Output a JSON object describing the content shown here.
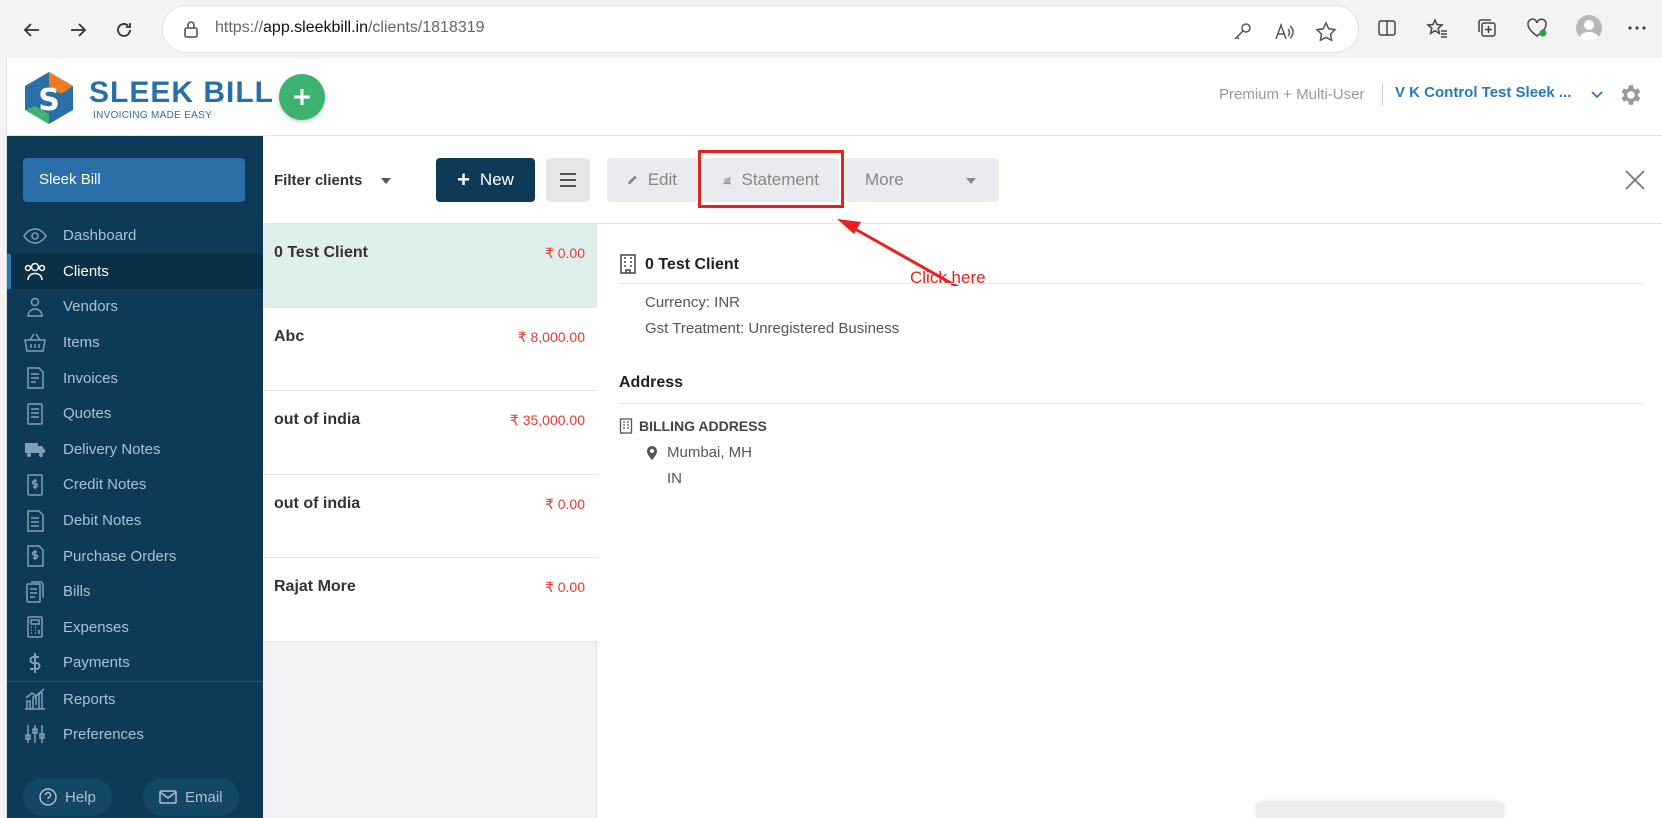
{
  "browser": {
    "url_prefix": "https://",
    "url_domain": "app.sleekbill.in",
    "url_path": "/clients/1818319"
  },
  "header": {
    "logo_text": "SLEEK BILL",
    "logo_tagline": "INVOICING MADE EASY",
    "plan": "Premium + Multi-User",
    "company": "V K Control Test Sleek ..."
  },
  "sidebar": {
    "brand_button": "Sleek Bill",
    "items": [
      {
        "label": "Dashboard",
        "icon": "eye-icon"
      },
      {
        "label": "Clients",
        "icon": "users-icon",
        "active": true
      },
      {
        "label": "Vendors",
        "icon": "vendor-icon"
      },
      {
        "label": "Items",
        "icon": "basket-icon"
      },
      {
        "label": "Invoices",
        "icon": "invoice-icon"
      },
      {
        "label": "Quotes",
        "icon": "quote-icon"
      },
      {
        "label": "Delivery Notes",
        "icon": "truck-icon"
      },
      {
        "label": "Credit Notes",
        "icon": "credit-note-icon"
      },
      {
        "label": "Debit Notes",
        "icon": "debit-note-icon"
      },
      {
        "label": "Purchase Orders",
        "icon": "purchase-order-icon"
      },
      {
        "label": "Bills",
        "icon": "bills-icon"
      },
      {
        "label": "Expenses",
        "icon": "calculator-icon"
      },
      {
        "label": "Payments",
        "icon": "dollar-icon"
      },
      {
        "label": "Reports",
        "icon": "chart-icon"
      },
      {
        "label": "Preferences",
        "icon": "sliders-icon"
      }
    ],
    "help_label": "Help",
    "email_label": "Email"
  },
  "list": {
    "filter_label": "Filter clients",
    "new_label": "New",
    "clients": [
      {
        "name": "0 Test Client",
        "amount": "₹ 0.00",
        "selected": true
      },
      {
        "name": "Abc",
        "amount": "₹ 8,000.00"
      },
      {
        "name": "out of india",
        "amount": "₹ 35,000.00"
      },
      {
        "name": "out of india",
        "amount": "₹ 0.00"
      },
      {
        "name": "Rajat More",
        "amount": "₹ 0.00"
      }
    ]
  },
  "detail": {
    "edit_label": "Edit",
    "statement_label": "Statement",
    "more_label": "More",
    "annotation": "Click here",
    "client_name": "0 Test Client",
    "currency": "Currency: INR",
    "gst": "Gst Treatment: Unregistered Business",
    "address_heading": "Address",
    "billing_heading": "BILLING ADDRESS",
    "city": "Mumbai, MH",
    "country": "IN"
  },
  "colors": {
    "sidebar": "#0d3b57",
    "accent": "#2a6fa8",
    "fab": "#3cb371",
    "annotation": "#e8201e",
    "amount": "#e53935"
  }
}
